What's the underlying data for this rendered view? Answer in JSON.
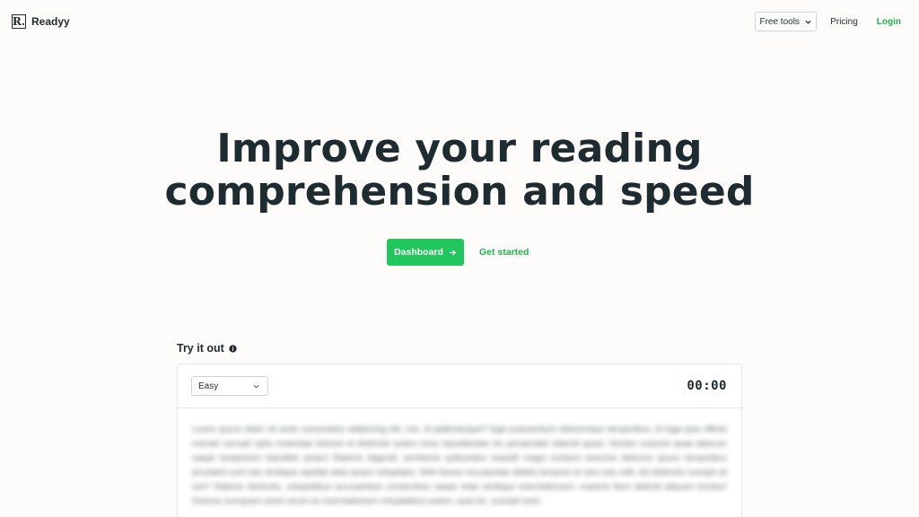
{
  "header": {
    "logo_letter": "R.",
    "brand_name": "Readyy",
    "free_tools_label": "Free tools",
    "pricing_label": "Pricing",
    "login_label": "Login"
  },
  "hero": {
    "title_line1": "Improve your reading",
    "title_line2": "comprehension and speed",
    "dashboard_label": "Dashboard",
    "get_started_label": "Get started"
  },
  "try_it": {
    "label": "Try it out",
    "level_selected": "Easy",
    "timer": "00:00",
    "passage": "Lorem ipsum dolor sit amet consectetur adipiscing elit, nisl, id pellentesque? fugit praesentium doloremque temporibus, id fuga ipsa officiis eveniet corrupti optio molestiae dolores et distinctio autem esse repudiandae hic perspiciatis deleniti quasi. Veniam corporis quae laborum saepe laudantium blanditiis ipsam! Ratione eligendi, architecto quibusdam impedit magni incidunt nesciunt delectus ipsum temporibus provident sunt iste similique repellat alias ipsam voluptates. Nihil facere recusandae debitis tempora et vero eos velit. Ad distinctio suscipit sit iure? Ratione distinctio, voluptatibus accusantium consectetur saepe vitae similique exercitationem, maxime illum deleniti aliquam tenetur! Dolores numquam animi rerum ex exercitationem voluptatibus autem, quia hic, suscipit iusto."
  },
  "colors": {
    "accent": "#22c55e",
    "text_dark": "#1e2b30",
    "background": "#fdfcfa"
  },
  "icons": {
    "free_tools_chevron": "chevron-down-icon",
    "dashboard_arrow": "arrow-right-icon",
    "info": "info-icon",
    "select_chevron": "chevron-down-icon"
  }
}
